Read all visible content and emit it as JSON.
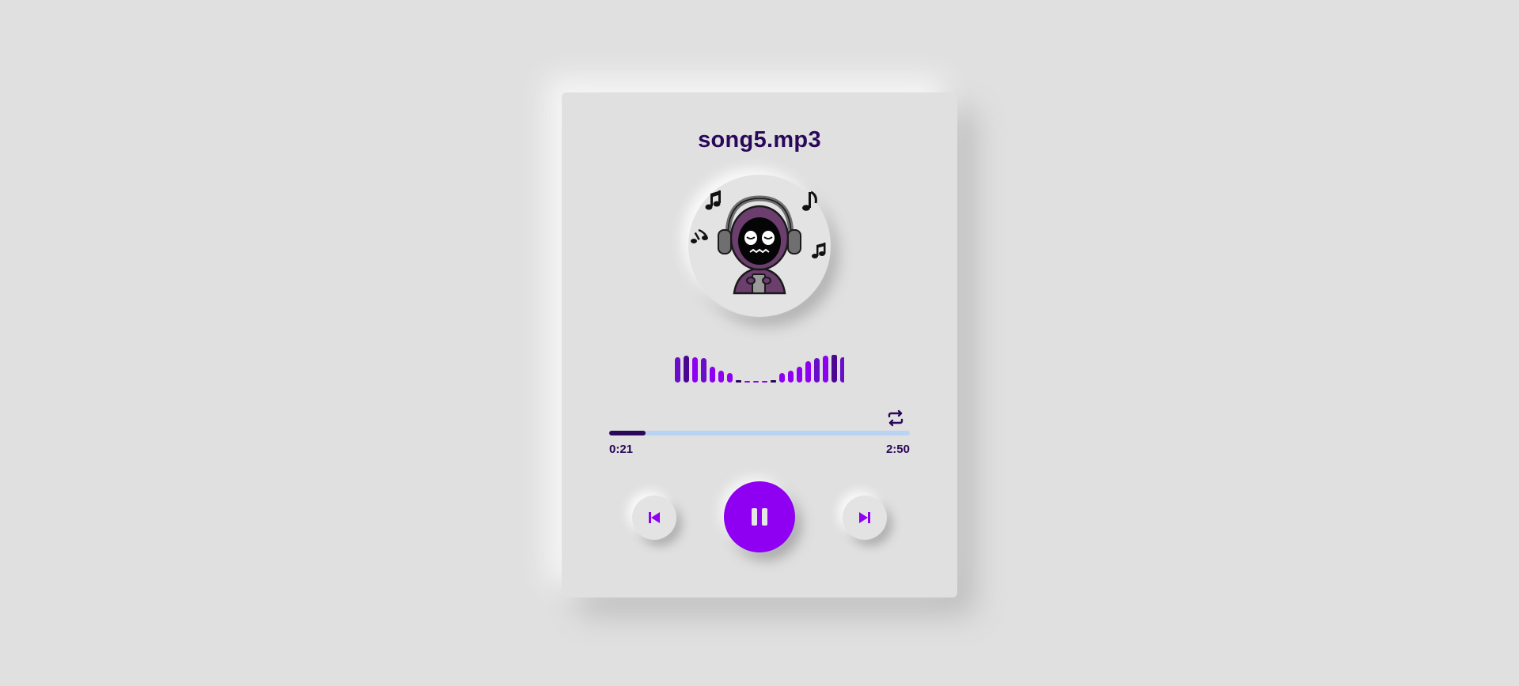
{
  "player": {
    "title": "song5.mp3",
    "current_time": "0:21",
    "duration": "2:50",
    "progress": 0.12
  },
  "visualizer": {
    "levels": [
      0.95,
      1.0,
      0.95,
      0.9,
      0.6,
      0.45,
      0.35,
      0.1,
      0.05,
      0.05,
      0.05,
      0.1,
      0.35,
      0.45,
      0.6,
      0.8,
      0.9,
      1.0,
      1.05,
      0.95
    ],
    "colors": [
      "#6a0fc7",
      "#4a0890",
      "#8f00f2",
      "#6a0fc7",
      "#8f00f2",
      "#8f00f2",
      "#8f00f2",
      "#2a0859",
      "#8f00f2",
      "#8f00f2",
      "#8f00f2",
      "#2a0859",
      "#8f00f2",
      "#8f00f2",
      "#8f00f2",
      "#8f00f2",
      "#6a0fc7",
      "#8f00f2",
      "#4a0890",
      "#6a0fc7"
    ]
  },
  "icons": {
    "repeat": "repeat-icon",
    "prev": "skip-previous-icon",
    "play_pause": "pause-icon",
    "next": "skip-next-icon",
    "art": "hooded-listener-with-headphones-illustration"
  },
  "colors": {
    "background": "#e0e0e0",
    "accent": "#8f00f2",
    "text": "#2a0859",
    "track": "#b8d4f2"
  }
}
